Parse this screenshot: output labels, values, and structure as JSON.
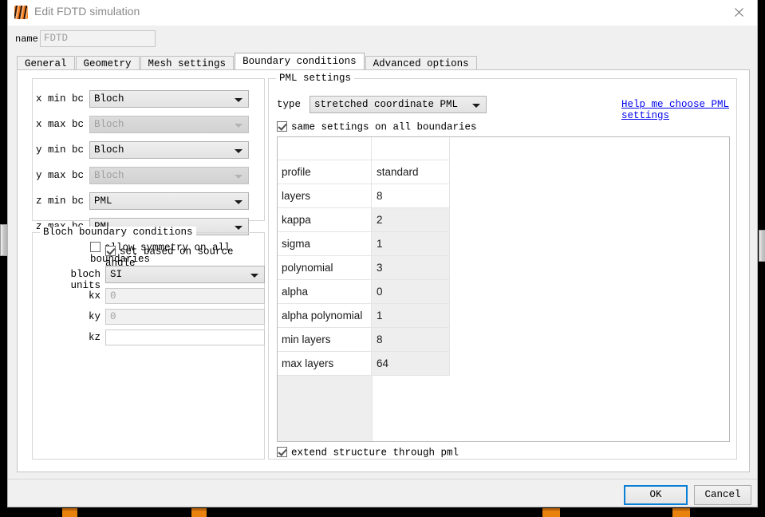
{
  "window": {
    "title": "Edit FDTD simulation",
    "icon": "lumerical-logo-icon",
    "close_icon": "close-icon"
  },
  "name_field": {
    "label": "name",
    "value": "FDTD",
    "placeholder": "FDTD"
  },
  "tabs": [
    {
      "label": "General",
      "active": false
    },
    {
      "label": "Geometry",
      "active": false
    },
    {
      "label": "Mesh settings",
      "active": false
    },
    {
      "label": "Boundary conditions",
      "active": true
    },
    {
      "label": "Advanced options",
      "active": false
    }
  ],
  "boundary_group": {
    "rows": [
      {
        "label": "x min bc",
        "value": "Bloch",
        "disabled": false
      },
      {
        "label": "x max bc",
        "value": "Bloch",
        "disabled": true
      },
      {
        "label": "y min bc",
        "value": "Bloch",
        "disabled": false
      },
      {
        "label": "y max bc",
        "value": "Bloch",
        "disabled": true
      },
      {
        "label": "z min bc",
        "value": "PML",
        "disabled": false
      },
      {
        "label": "z max bc",
        "value": "PML",
        "disabled": false
      }
    ],
    "allow_symmetry": {
      "label": "allow symmetry on all boundaries",
      "checked": false
    }
  },
  "bloch_group": {
    "title": "Bloch boundary conditions",
    "set_based_on_source_angle": {
      "label": "set based on source angle",
      "checked": true
    },
    "units_label": "bloch units",
    "units_value": "SI",
    "fields": [
      {
        "label": "kx",
        "value": "0",
        "disabled": true
      },
      {
        "label": "ky",
        "value": "0",
        "disabled": true
      },
      {
        "label": "kz",
        "value": "",
        "disabled": false
      }
    ]
  },
  "pml_group": {
    "title": "PML settings",
    "type_label": "type",
    "type_value": "stretched coordinate PML",
    "help_link": "Help me choose PML settings",
    "same_settings": {
      "label": "same settings on all boundaries",
      "checked": true
    },
    "extend_structure": {
      "label": "extend structure through pml",
      "checked": true
    },
    "table": {
      "rows": [
        {
          "name": "profile",
          "value": "standard",
          "shaded": false
        },
        {
          "name": "layers",
          "value": "8",
          "shaded": false
        },
        {
          "name": "kappa",
          "value": "2",
          "shaded": true
        },
        {
          "name": "sigma",
          "value": "1",
          "shaded": true
        },
        {
          "name": "polynomial",
          "value": "3",
          "shaded": true
        },
        {
          "name": "alpha",
          "value": "0",
          "shaded": true
        },
        {
          "name": "alpha polynomial",
          "value": "1",
          "shaded": true
        },
        {
          "name": "min layers",
          "value": "8",
          "shaded": true
        },
        {
          "name": "max layers",
          "value": "64",
          "shaded": true
        }
      ]
    }
  },
  "footer": {
    "ok_label": "OK",
    "cancel_label": "Cancel"
  },
  "colors": {
    "accent": "#0a7fd6",
    "link": "#0000ee",
    "taskbar_mark": "#e8820c",
    "table_shade": "#eeeeee"
  }
}
